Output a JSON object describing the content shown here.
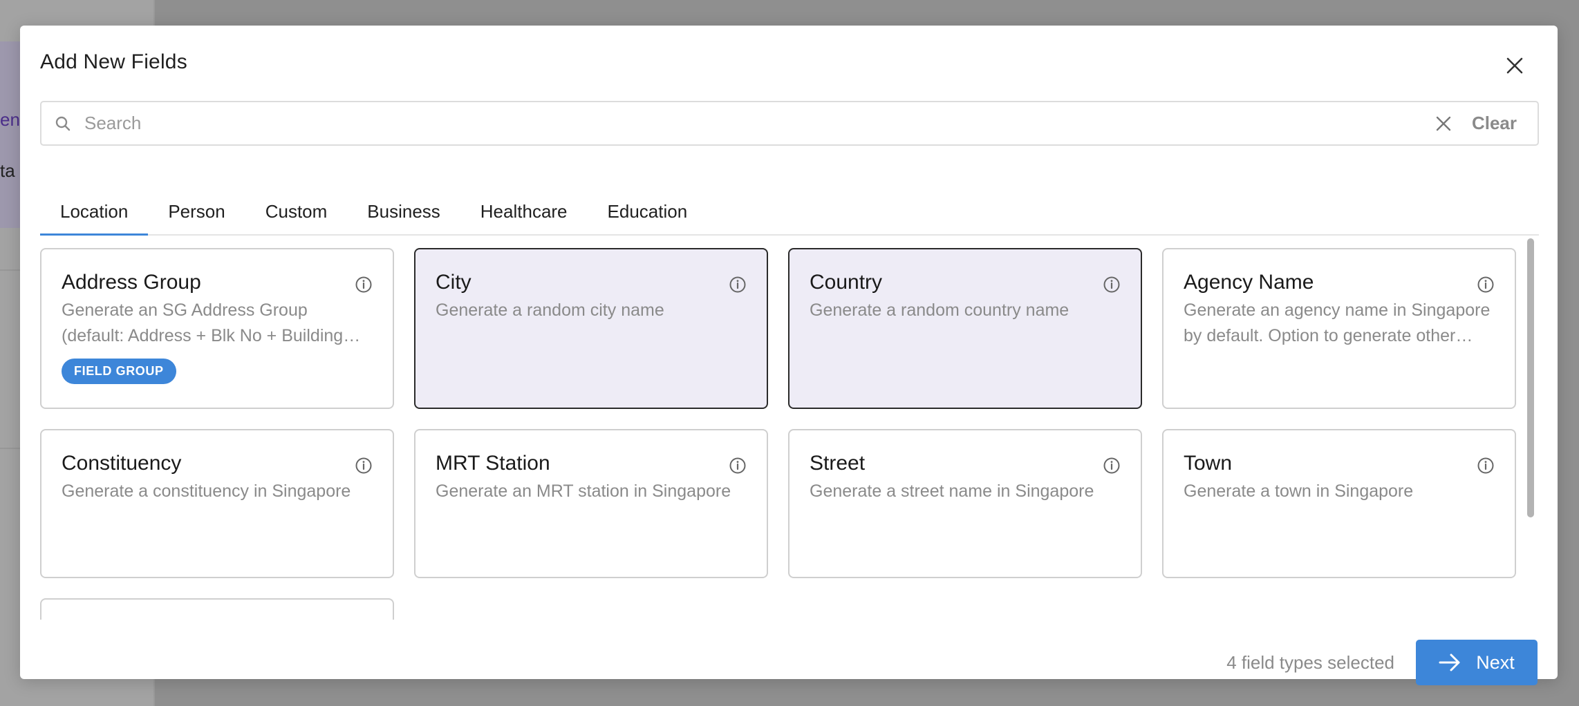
{
  "background": {
    "sidebar_text_1": "en",
    "sidebar_text_2": "ta"
  },
  "modal": {
    "title": "Add New Fields",
    "close_icon": "close-icon"
  },
  "search": {
    "placeholder": "Search",
    "value": "",
    "clear_label": "Clear"
  },
  "tabs": [
    {
      "label": "Location",
      "active": true
    },
    {
      "label": "Person"
    },
    {
      "label": "Custom"
    },
    {
      "label": "Business"
    },
    {
      "label": "Healthcare"
    },
    {
      "label": "Education"
    }
  ],
  "cards": [
    {
      "title": "Address Group",
      "description": "Generate an SG Address Group (default: Address + Blk No + Building Name + Postal Code)",
      "badge": "FIELD GROUP",
      "selected": false
    },
    {
      "title": "City",
      "description": "Generate a random city name",
      "selected": true
    },
    {
      "title": "Country",
      "description": "Generate a random country name",
      "selected": true
    },
    {
      "title": "Agency Name",
      "description": "Generate an agency name in Singapore by default. Option to generate other countries.",
      "selected": false
    },
    {
      "title": "Constituency",
      "description": "Generate a constituency in Singapore",
      "selected": false
    },
    {
      "title": "MRT Station",
      "description": "Generate an MRT station in Singapore",
      "selected": false
    },
    {
      "title": "Street",
      "description": "Generate a street name in Singapore",
      "selected": false
    },
    {
      "title": "Town",
      "description": "Generate a town in Singapore",
      "selected": false
    }
  ],
  "footer": {
    "selected_count_text": "4 field types selected",
    "next_label": "Next"
  },
  "colors": {
    "accent": "#3d86d9",
    "selected_card_bg": "#eeecf6"
  }
}
